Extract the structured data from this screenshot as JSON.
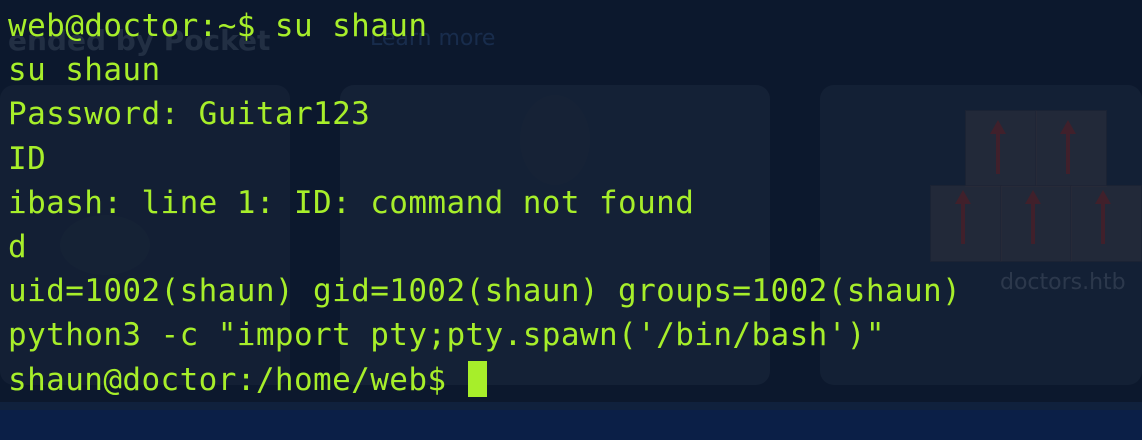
{
  "background": {
    "title_fragment": "ended by Pocket",
    "learn_more": "Learn more",
    "url_fragment": "doctors.htb"
  },
  "terminal": {
    "colors": {
      "foreground": "#a7ee2a",
      "background": "#0c1626"
    },
    "lines": [
      "web@doctor:~$ su shaun",
      "su shaun",
      "Password: Guitar123",
      "ID",
      "ibash: line 1: ID: command not found",
      "d",
      "uid=1002(shaun) gid=1002(shaun) groups=1002(shaun)",
      "python3 -c \"import pty;pty.spawn('/bin/bash')\"",
      "shaun@doctor:/home/web$ "
    ]
  }
}
